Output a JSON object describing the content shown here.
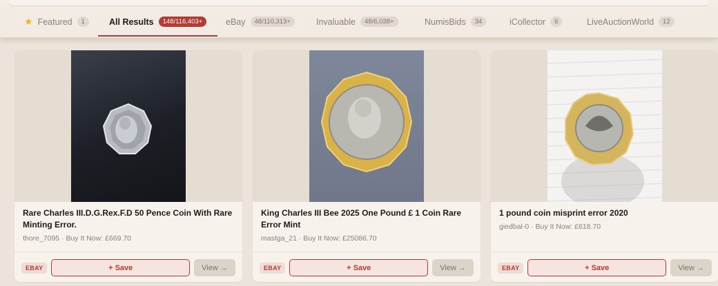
{
  "tabs": [
    {
      "label": "Featured",
      "count": "1",
      "icon": "star-icon"
    },
    {
      "label": "All Results",
      "count": "148/116,403+",
      "active": true
    },
    {
      "label": "eBay",
      "count": "48/110,313+"
    },
    {
      "label": "Invaluable",
      "count": "48/6,038+"
    },
    {
      "label": "NumisBids",
      "count": "34"
    },
    {
      "label": "iCollector",
      "count": "6"
    },
    {
      "label": "LiveAuctionWorld",
      "count": "12"
    }
  ],
  "cards": [
    {
      "title": "Rare Charles III.D.G.Rex.F.D 50 Pence Coin With Rare Minting Error.",
      "meta": "thore_7095 · Buy It Now: £669.70",
      "source": "EBAY",
      "save_label": "+ Save",
      "view_label": "View →"
    },
    {
      "title": "King Charles III Bee 2025 One Pound £ 1 Coin Rare Error Mint",
      "meta": "mastga_21 · Buy It Now: £25086.70",
      "source": "EBAY",
      "save_label": "+ Save",
      "view_label": "View →"
    },
    {
      "title": "1 pound coin misprint error 2020",
      "meta": "giedbal-0 · Buy It Now: £618.70",
      "source": "EBAY",
      "save_label": "+ Save",
      "view_label": "View →"
    }
  ],
  "colors": {
    "accent": "#b53a33",
    "background": "#ece4da",
    "card": "#f7f2ec"
  }
}
